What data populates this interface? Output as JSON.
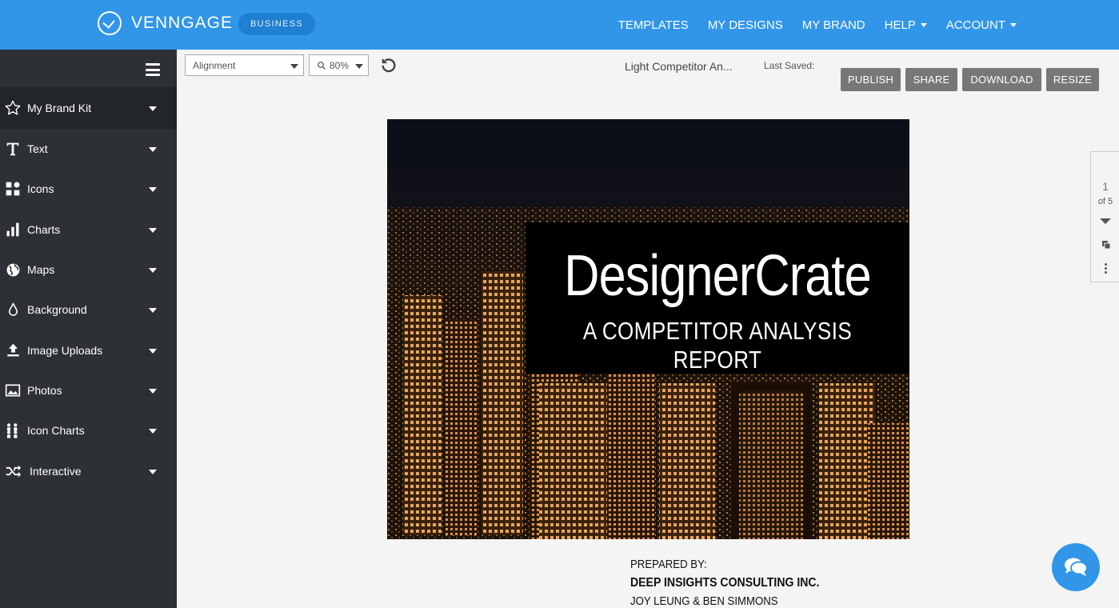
{
  "header": {
    "brand": "VENNGAGE",
    "plan_badge": "BUSINESS",
    "nav": [
      {
        "label": "TEMPLATES"
      },
      {
        "label": "MY DESIGNS"
      },
      {
        "label": "MY BRAND"
      },
      {
        "label": "HELP"
      },
      {
        "label": "ACCOUNT"
      }
    ]
  },
  "sidebar": {
    "items": [
      {
        "label": "My Brand Kit",
        "icon": "star-icon"
      },
      {
        "label": "Text",
        "icon": "text-icon"
      },
      {
        "label": "Icons",
        "icon": "shapes-icon"
      },
      {
        "label": "Charts",
        "icon": "bar-chart-icon"
      },
      {
        "label": "Maps",
        "icon": "globe-icon"
      },
      {
        "label": "Background",
        "icon": "droplet-icon"
      },
      {
        "label": "Image Uploads",
        "icon": "upload-icon"
      },
      {
        "label": "Photos",
        "icon": "photo-icon"
      },
      {
        "label": "Icon Charts",
        "icon": "people-chart-icon"
      },
      {
        "label": "Interactive",
        "icon": "shuffle-icon"
      }
    ]
  },
  "toolbar": {
    "alignment_label": "Alignment",
    "zoom_label": "80%",
    "doc_title": "Light Competitor An...",
    "last_saved": "Last Saved:",
    "buttons": {
      "publish": "PUBLISH",
      "share": "SHARE",
      "download": "DOWNLOAD",
      "resize": "RESIZE"
    }
  },
  "design": {
    "title": "DesignerCrate",
    "subtitle": "A COMPETITOR ANALYSIS REPORT",
    "prepared_label": "PREPARED BY:",
    "company": "DEEP INSIGHTS CONSULTING INC.",
    "names": "JOY LEUNG & BEN SIMMONS"
  },
  "page_nav": {
    "current": "1",
    "total_label": "of 5"
  },
  "colors": {
    "header_blue": "#3196e8",
    "sidebar_dark": "#2d3035",
    "button_gray": "#777777"
  }
}
